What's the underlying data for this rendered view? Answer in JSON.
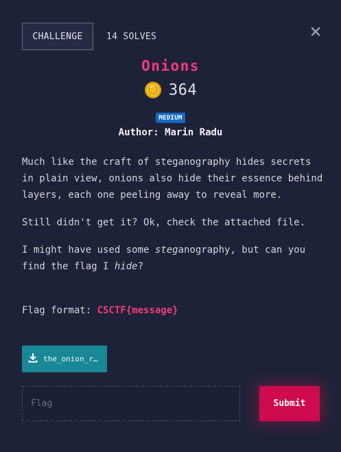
{
  "tabs": {
    "challenge_label": "CHALLENGE",
    "solves_label": "14 SOLVES"
  },
  "challenge": {
    "name": "Onions",
    "points": "364",
    "difficulty": "MEDIUM",
    "author": "Author: Marin Radu"
  },
  "description": {
    "p1": "Much like the craft of steganography hides secrets in plain view, onions also hide their essence behind layers, each one peeling away to reveal more.",
    "p2": "Still didn't get it? Ok, check the attached file.",
    "p3_a": "I might have used some ",
    "p3_em1": "steg",
    "p3_b": "anography, but can you find the flag I ",
    "p3_em2": "hide",
    "p3_c": "?",
    "flag_format_label": "Flag format: ",
    "flag_format_value": "CSCTF{message}"
  },
  "attachment": {
    "file_label": "the_onion_r…",
    "icon": "download-icon"
  },
  "submission": {
    "placeholder": "Flag",
    "submit_label": "Submit"
  },
  "colors": {
    "background": "#1e2238",
    "accent": "#f03c7e",
    "submit": "#cf0a4e",
    "file_button": "#1a8795",
    "badge": "#1769c2"
  }
}
